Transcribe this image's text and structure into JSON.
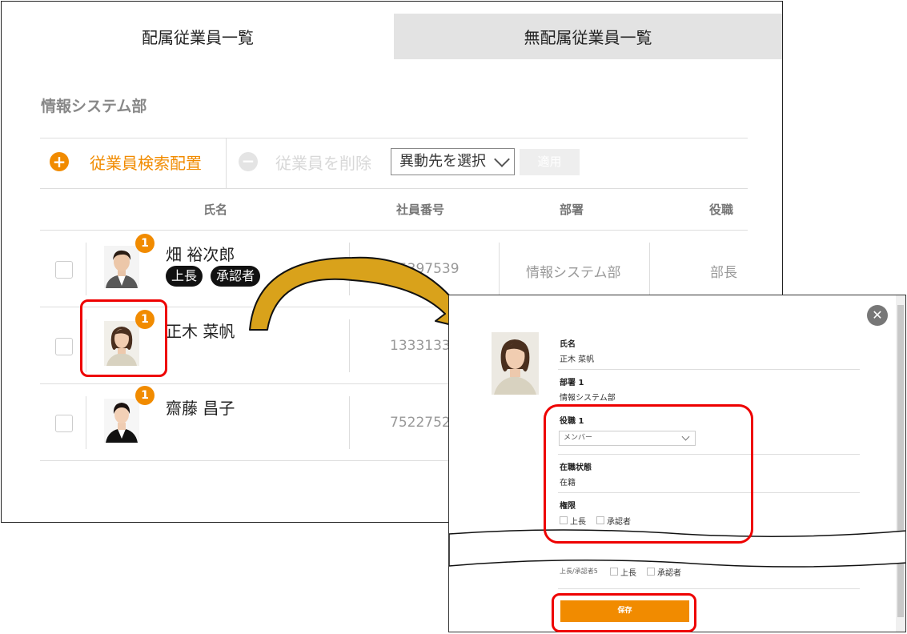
{
  "tabs": {
    "assigned": "配属従業員一覧",
    "unassigned": "無配属従業員一覧"
  },
  "department_title": "情報システム部",
  "toolbar": {
    "add_label": "従業員検索配置",
    "add_icon": "plus-circle-icon",
    "remove_label": "従業員を削除",
    "remove_icon": "minus-circle-icon",
    "transfer_select": "異動先を選択",
    "apply_label": "適用"
  },
  "table": {
    "headers": {
      "name": "氏名",
      "employee_no": "社員番号",
      "department": "部署",
      "position": "役職"
    },
    "rows": [
      {
        "badge": "1",
        "name": "畑 裕次郎",
        "tags": [
          "上長",
          "承認者"
        ],
        "employee_no": "75397539",
        "department": "情報システム部",
        "position": "部長"
      },
      {
        "badge": "1",
        "name": "正木 菜帆",
        "employee_no": "1333133"
      },
      {
        "badge": "1",
        "name": "齋藤 昌子",
        "employee_no": "7522752"
      }
    ]
  },
  "detail_panel": {
    "close_icon": "close-icon",
    "name_label": "氏名",
    "name_value": "正木 菜帆",
    "dept_label": "部署 1",
    "dept_value": "情報システム部",
    "position_label": "役職 1",
    "position_select": "メンバー",
    "employment_label": "在職状態",
    "employment_value": "在籍",
    "permission_label": "権限",
    "permission_options": [
      "上長",
      "承認者"
    ],
    "permission5_label": "上長/承認者5",
    "permission5_options": [
      "上長",
      "承認者"
    ],
    "save_label": "保存"
  },
  "colors": {
    "accent": "#f18b00",
    "highlight": "#e00000",
    "arrow": "#d9a21b"
  }
}
